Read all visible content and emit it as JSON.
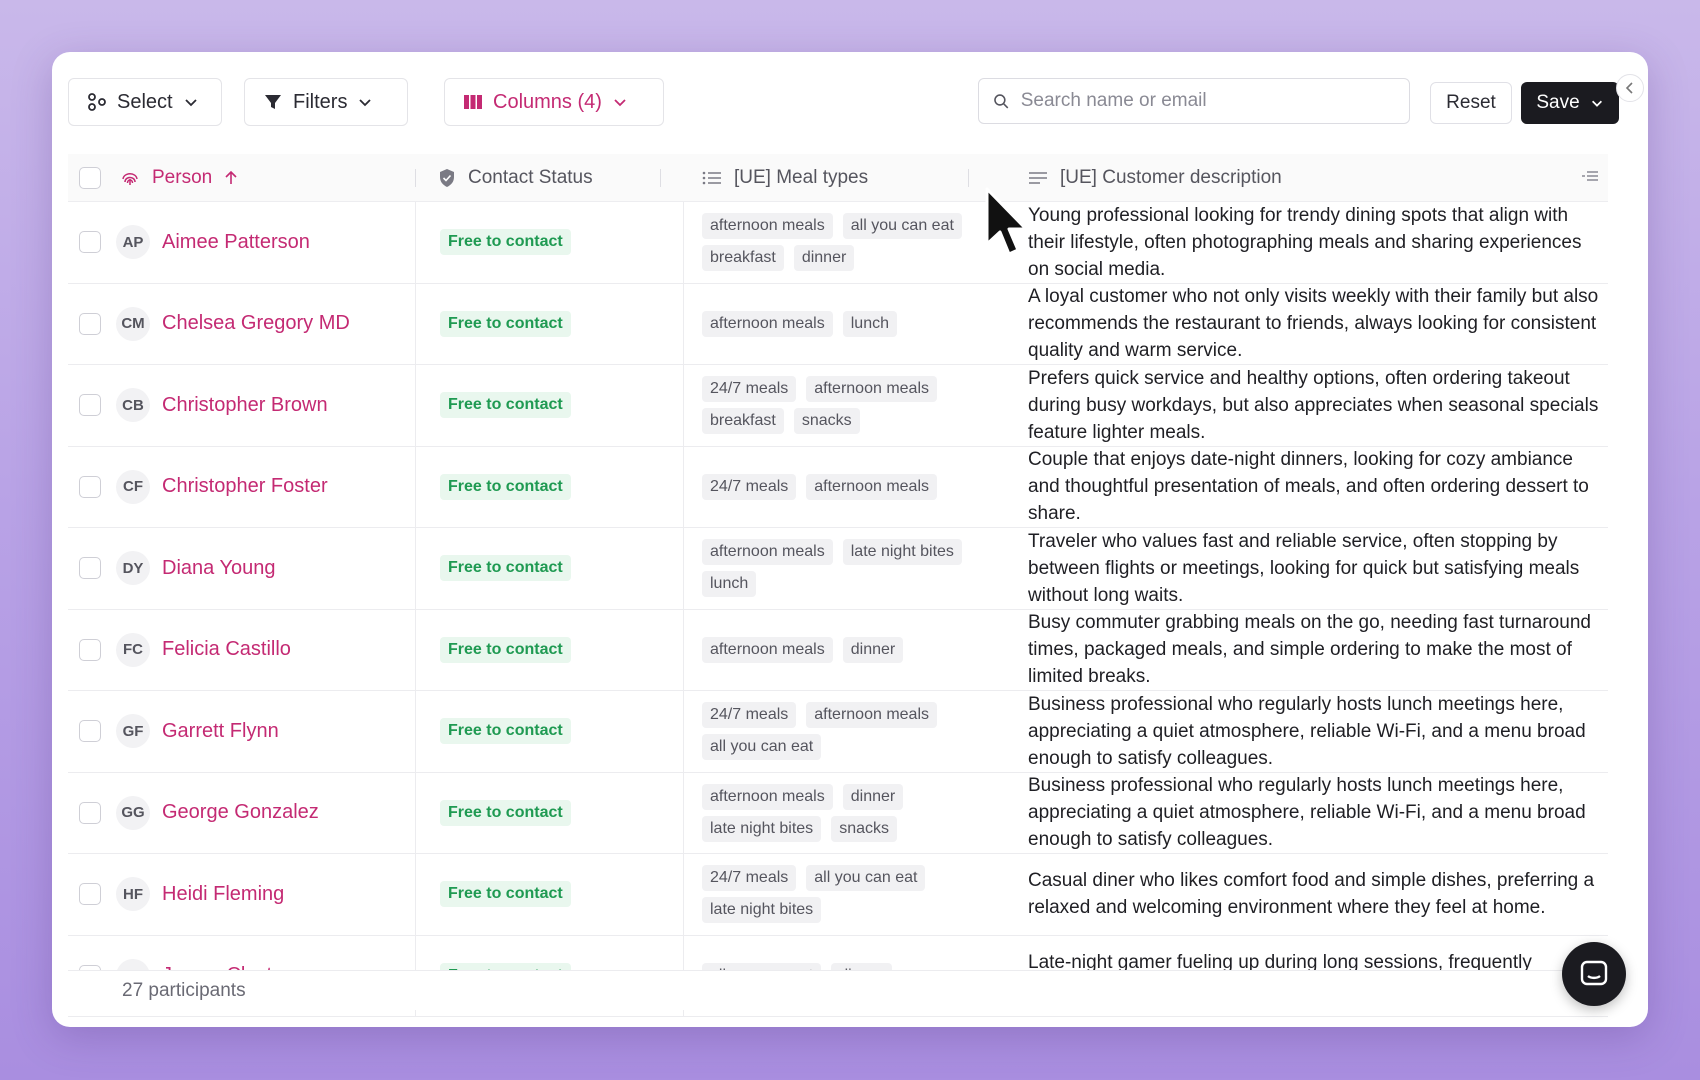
{
  "toolbar": {
    "select_label": "Select",
    "filters_label": "Filters",
    "columns_label": "Columns (4)",
    "search_placeholder": "Search name or email",
    "reset_label": "Reset",
    "save_label": "Save"
  },
  "columns": {
    "person": "Person",
    "status": "Contact Status",
    "meal": "[UE] Meal types",
    "description": "[UE] Customer description"
  },
  "rows": [
    {
      "initials": "AP",
      "name": "Aimee Patterson",
      "status": "Free to contact",
      "meals": [
        "afternoon meals",
        "all you can eat",
        "breakfast",
        "dinner"
      ],
      "description": "Young professional looking for trendy dining spots that align with their lifestyle, often photographing meals and sharing experiences on social media."
    },
    {
      "initials": "CM",
      "name": "Chelsea Gregory MD",
      "status": "Free to contact",
      "meals": [
        "afternoon meals",
        "lunch"
      ],
      "description": "A loyal customer who not only visits weekly with their family but also recommends the restaurant to friends, always looking for consistent quality and warm service."
    },
    {
      "initials": "CB",
      "name": "Christopher Brown",
      "status": "Free to contact",
      "meals": [
        "24/7 meals",
        "afternoon meals",
        "breakfast",
        "snacks"
      ],
      "description": "Prefers quick service and healthy options, often ordering takeout during busy workdays, but also appreciates when seasonal specials feature lighter meals."
    },
    {
      "initials": "CF",
      "name": "Christopher Foster",
      "status": "Free to contact",
      "meals": [
        "24/7 meals",
        "afternoon meals"
      ],
      "description": "Couple that enjoys date-night dinners, looking for cozy ambiance and thoughtful presentation of meals, and often ordering dessert to share."
    },
    {
      "initials": "DY",
      "name": "Diana Young",
      "status": "Free to contact",
      "meals": [
        "afternoon meals",
        "late night bites",
        "lunch"
      ],
      "description": "Traveler who values fast and reliable service, often stopping by between flights or meetings, looking for quick but satisfying meals without long waits."
    },
    {
      "initials": "FC",
      "name": "Felicia Castillo",
      "status": "Free to contact",
      "meals": [
        "afternoon meals",
        "dinner"
      ],
      "description": "Busy commuter grabbing meals on the go, needing fast turnaround times, packaged meals, and simple ordering to make the most of limited breaks."
    },
    {
      "initials": "GF",
      "name": "Garrett Flynn",
      "status": "Free to contact",
      "meals": [
        "24/7 meals",
        "afternoon meals",
        "all you can eat"
      ],
      "description": "Business professional who regularly hosts lunch meetings here, appreciating a quiet atmosphere, reliable Wi-Fi, and a menu broad enough to satisfy colleagues."
    },
    {
      "initials": "GG",
      "name": "George Gonzalez",
      "status": "Free to contact",
      "meals": [
        "afternoon meals",
        "dinner",
        "late night bites",
        "snacks"
      ],
      "description": "Business professional who regularly hosts lunch meetings here, appreciating a quiet atmosphere, reliable Wi-Fi, and a menu broad enough to satisfy colleagues."
    },
    {
      "initials": "HF",
      "name": "Heidi Fleming",
      "status": "Free to contact",
      "meals": [
        "24/7 meals",
        "all you can eat",
        "late night bites"
      ],
      "description": "Casual diner who likes comfort food and simple dishes, preferring a relaxed and welcoming environment where they feel at home."
    },
    {
      "initials": "JC",
      "name": "James Clayton",
      "status": "Free to contact",
      "meals": [
        "all you can eat",
        "dinner"
      ],
      "description": "Late-night gamer fueling up during long sessions, frequently ordering comfort food and snacks for delivery, relying on consist"
    }
  ],
  "footer": {
    "count_text": "27 participants"
  },
  "colors": {
    "accent": "#c42a73",
    "status_green": "#1f9a52",
    "dark": "#1b1b20"
  }
}
